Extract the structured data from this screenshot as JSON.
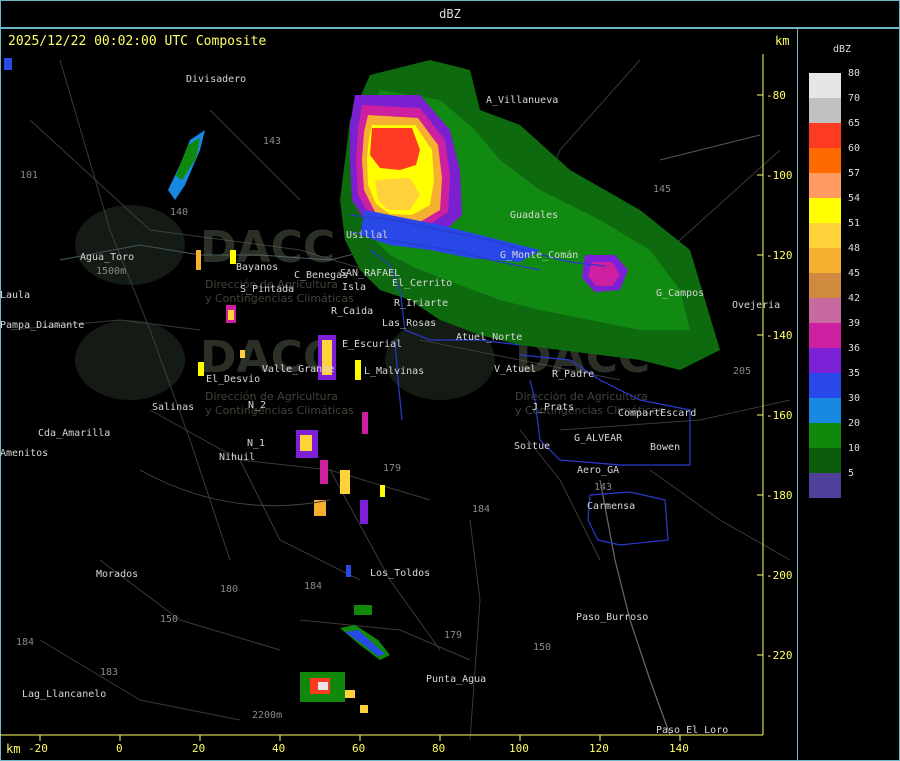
{
  "top_bar": {
    "unit_label": "dBZ"
  },
  "header": {
    "timestamp": "2025/12/22 00:02:00 UTC Composite",
    "km_label": "km"
  },
  "axis": {
    "x_unit": "km",
    "x_ticks": [
      "-20",
      "0",
      "20",
      "40",
      "60",
      "80",
      "100",
      "120",
      "140"
    ],
    "y_ticks": [
      "-80",
      "-100",
      "-120",
      "-140",
      "-160",
      "-180",
      "-200",
      "-220"
    ]
  },
  "places": [
    "Divisadero",
    "A_Villanueva",
    "Guadales",
    "G_Campos",
    "Ovejeria",
    "Agua_Toro",
    "Bayanos",
    "S_Pintada",
    "R_Caida",
    "Usillal",
    "SAN_RAFAEL",
    "Isla",
    "C_Benegas",
    "El_Cerrito",
    "Las_Rosas",
    "Atuel_Norte",
    "E_Escurial",
    "Valle_Grande",
    "L_Malvinas",
    "El_Desvio",
    "Salinas",
    "Cda_Amarilla",
    "Amenitos",
    "Nihuil",
    "N_1",
    "N_2",
    "Pampa_Diamante",
    "Laula",
    "V_Atuel",
    "R_Padre",
    "J_Prats",
    "CompartEscard",
    "G_ALVEAR",
    "Bowen",
    "Soitue",
    "Aero_GA",
    "Carmensa",
    "Los_Toldos",
    "Morados",
    "Paso_Burroso",
    "Punta_Agua",
    "Lag_Llancanelo",
    "Paso_El_Loro",
    "R_Iriarte",
    "G_Monte_Comán"
  ],
  "range_labels": [
    "143",
    "101",
    "145",
    "140",
    "150",
    "179",
    "184",
    "180",
    "184",
    "183",
    "179",
    "150",
    "143",
    "184",
    "205",
    "2200m",
    "1500m"
  ],
  "watermark": {
    "brand": "DACC",
    "line1": "Dirección de Agricultura",
    "line2": "y Contingencias Climáticas"
  },
  "legend": {
    "title": "dBZ",
    "entries": [
      {
        "label": "80",
        "color": "#e6e6e6"
      },
      {
        "label": "70",
        "color": "#c0c0c0"
      },
      {
        "label": "65",
        "color": "#ff3a22"
      },
      {
        "label": "60",
        "color": "#ff6a00"
      },
      {
        "label": "57",
        "color": "#ff9a60"
      },
      {
        "label": "54",
        "color": "#ffff00"
      },
      {
        "label": "51",
        "color": "#ffd23a"
      },
      {
        "label": "48",
        "color": "#f5b030"
      },
      {
        "label": "45",
        "color": "#d08a40"
      },
      {
        "label": "42",
        "color": "#c86aa0"
      },
      {
        "label": "39",
        "color": "#cc20a0"
      },
      {
        "label": "36",
        "color": "#7c20d8"
      },
      {
        "label": "35",
        "color": "#2848e8"
      },
      {
        "label": "30",
        "color": "#1888e0"
      },
      {
        "label": "20",
        "color": "#10880c"
      },
      {
        "label": "10",
        "color": "#0c5c0c"
      },
      {
        "label": "5",
        "color": "#50409c"
      }
    ]
  }
}
